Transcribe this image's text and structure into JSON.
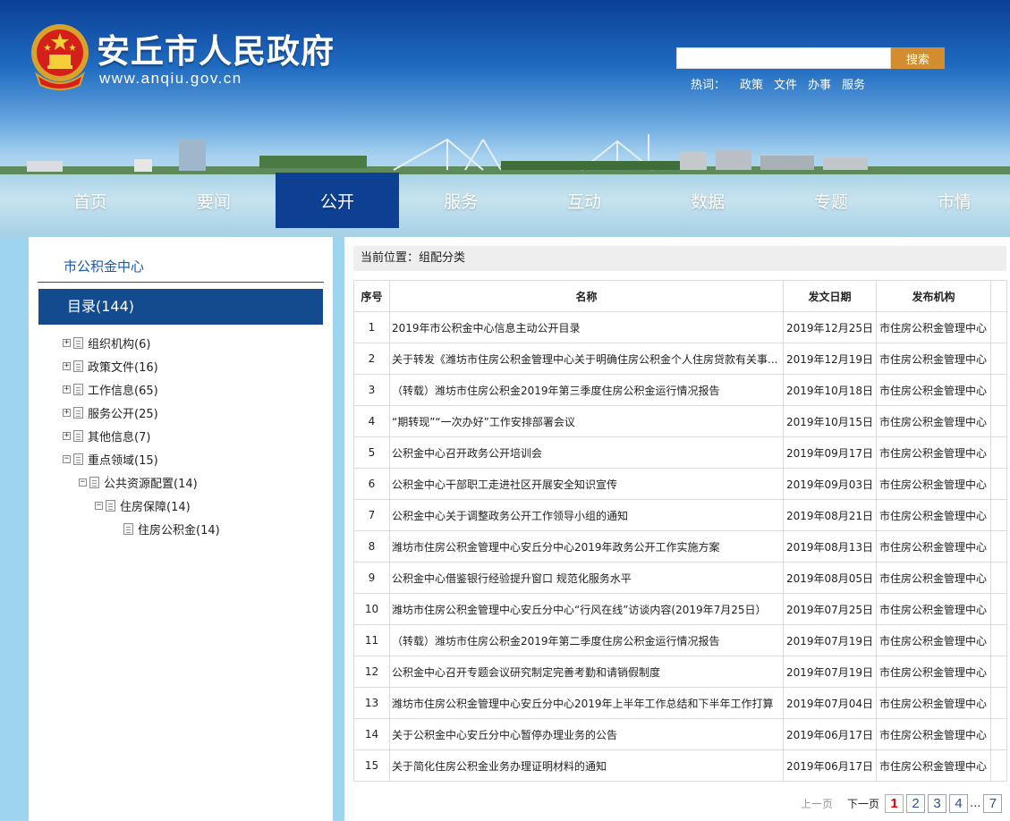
{
  "header": {
    "site_name": "安丘市人民政府",
    "site_url": "www.anqiu.gov.cn",
    "search": {
      "placeholder": "",
      "button_label": "搜索"
    },
    "hotwords_label": "热词：",
    "hotwords": [
      "政策",
      "文件",
      "办事",
      "服务"
    ]
  },
  "nav": {
    "items": [
      "首页",
      "要闻",
      "公开",
      "服务",
      "互动",
      "数据",
      "专题",
      "市情"
    ],
    "active_index": 2
  },
  "sidebar": {
    "department": "市公积金中心",
    "catalog_label": "目录(144)",
    "tree": [
      {
        "label": "组织机构(6)",
        "level": 0,
        "expanded": false
      },
      {
        "label": "政策文件(16)",
        "level": 0,
        "expanded": false
      },
      {
        "label": "工作信息(65)",
        "level": 0,
        "expanded": false
      },
      {
        "label": "服务公开(25)",
        "level": 0,
        "expanded": false
      },
      {
        "label": "其他信息(7)",
        "level": 0,
        "expanded": false
      },
      {
        "label": "重点领域(15)",
        "level": 0,
        "expanded": true
      },
      {
        "label": "公共资源配置(14)",
        "level": 1,
        "expanded": true
      },
      {
        "label": "住房保障(14)",
        "level": 2,
        "expanded": true
      },
      {
        "label": "住房公积金(14)",
        "level": 3,
        "expanded": null
      }
    ]
  },
  "main": {
    "breadcrumb": "当前位置：组配分类",
    "columns": [
      "序号",
      "名称",
      "发文日期",
      "发布机构"
    ],
    "rows": [
      {
        "no": "1",
        "name": "2019年市公积金中心信息主动公开目录",
        "date": "2019年12月25日",
        "org": "市住房公积金管理中心"
      },
      {
        "no": "2",
        "name": "关于转发《潍坊市住房公积金管理中心关于明确住房公积金个人住房贷款有关事...",
        "date": "2019年12月19日",
        "org": "市住房公积金管理中心"
      },
      {
        "no": "3",
        "name": "（转载）潍坊市住房公积金2019年第三季度住房公积金运行情况报告",
        "date": "2019年10月18日",
        "org": "市住房公积金管理中心"
      },
      {
        "no": "4",
        "name": "“期转现”“一次办好”工作安排部署会议",
        "date": "2019年10月15日",
        "org": "市住房公积金管理中心"
      },
      {
        "no": "5",
        "name": "公积金中心召开政务公开培训会",
        "date": "2019年09月17日",
        "org": "市住房公积金管理中心"
      },
      {
        "no": "6",
        "name": "公积金中心干部职工走进社区开展安全知识宣传",
        "date": "2019年09月03日",
        "org": "市住房公积金管理中心"
      },
      {
        "no": "7",
        "name": "公积金中心关于调整政务公开工作领导小组的通知",
        "date": "2019年08月21日",
        "org": "市住房公积金管理中心"
      },
      {
        "no": "8",
        "name": "潍坊市住房公积金管理中心安丘分中心2019年政务公开工作实施方案",
        "date": "2019年08月13日",
        "org": "市住房公积金管理中心"
      },
      {
        "no": "9",
        "name": "公积金中心借鉴银行经验提升窗口 规范化服务水平",
        "date": "2019年08月05日",
        "org": "市住房公积金管理中心"
      },
      {
        "no": "10",
        "name": "潍坊市住房公积金管理中心安丘分中心“行风在线”访谈内容(2019年7月25日）",
        "date": "2019年07月25日",
        "org": "市住房公积金管理中心"
      },
      {
        "no": "11",
        "name": "（转载）潍坊市住房公积金2019年第二季度住房公积金运行情况报告",
        "date": "2019年07月19日",
        "org": "市住房公积金管理中心"
      },
      {
        "no": "12",
        "name": "公积金中心召开专题会议研究制定完善考勤和请销假制度",
        "date": "2019年07月19日",
        "org": "市住房公积金管理中心"
      },
      {
        "no": "13",
        "name": "潍坊市住房公积金管理中心安丘分中心2019年上半年工作总结和下半年工作打算",
        "date": "2019年07月04日",
        "org": "市住房公积金管理中心"
      },
      {
        "no": "14",
        "name": "关于公积金中心安丘分中心暂停办理业务的公告",
        "date": "2019年06月17日",
        "org": "市住房公积金管理中心"
      },
      {
        "no": "15",
        "name": "关于简化住房公积金业务办理证明材料的通知",
        "date": "2019年06月17日",
        "org": "市住房公积金管理中心"
      }
    ],
    "pagination": {
      "prev_label": "上一页",
      "next_label": "下一页",
      "pages": [
        "1",
        "2",
        "3",
        "4"
      ],
      "current": "1",
      "ellipsis": "...",
      "last": "7"
    }
  },
  "colors": {
    "nav_active": "#0d3f92",
    "catalog_header": "#144b8f",
    "search_button": "#d18d2f",
    "current_page": "#e00000"
  }
}
